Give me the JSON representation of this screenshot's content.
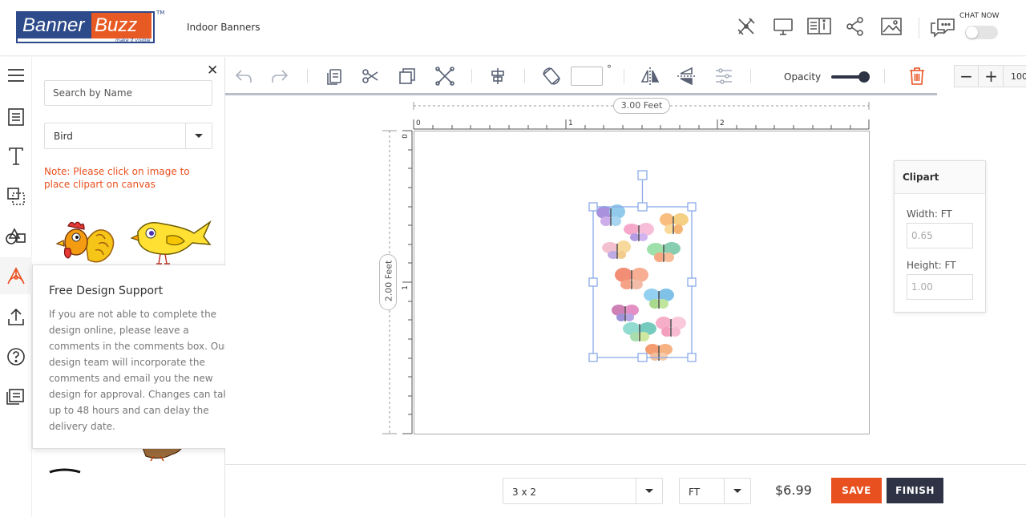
{
  "header": {
    "logo_banner": "Banner",
    "logo_buzz": "Buzz",
    "logo_tagline": "make it visible",
    "logo_tm": "TM",
    "product_title": "Indoor Banners",
    "icons": [
      "design-tools-icon",
      "preview-icon",
      "product-info-icon",
      "share-icon",
      "image-icon",
      "chat-icon"
    ],
    "chat_label": "CHAT NOW",
    "chat_enabled": false
  },
  "rail": {
    "items": [
      "menu-icon",
      "template-icon",
      "text-icon",
      "layers-icon",
      "shapes-icon",
      "clipart-icon",
      "upload-icon",
      "help-icon",
      "comments-icon"
    ],
    "active": "clipart-icon"
  },
  "panel": {
    "search_placeholder": "Search by Name",
    "category_value": "Bird",
    "note": "Note: Please click on image to place clipart on canvas"
  },
  "support_popup": {
    "title": "Free Design Support",
    "body": "If you are not able to complete the design online, please leave a comments in the comments box. Our design team will incorporate the comments and email you the new design for approval. Changes can take up to 48 hours and can delay the delivery date."
  },
  "toolbar": {
    "rotate_degree_symbol": "°",
    "opacity_label": "Opacity",
    "opacity_value": 1.0,
    "zoom_value": "100"
  },
  "canvas": {
    "width_label": "3.00 Feet",
    "height_label": "2.00 Feet",
    "ruler_h": [
      "0",
      "1",
      "2"
    ],
    "ruler_v": [
      "0",
      "1"
    ]
  },
  "props": {
    "title": "Clipart",
    "width_label": "Width: FT",
    "width_value": "0.65",
    "height_label": "Height: FT",
    "height_value": "1.00"
  },
  "footer": {
    "size_value": "3 x 2",
    "unit_value": "FT",
    "price": "$6.99",
    "save_label": "SAVE",
    "finish_label": "FINISH"
  },
  "colors": {
    "accent": "#e8501f",
    "dark": "#2e3445",
    "selection": "#8aaae8"
  }
}
